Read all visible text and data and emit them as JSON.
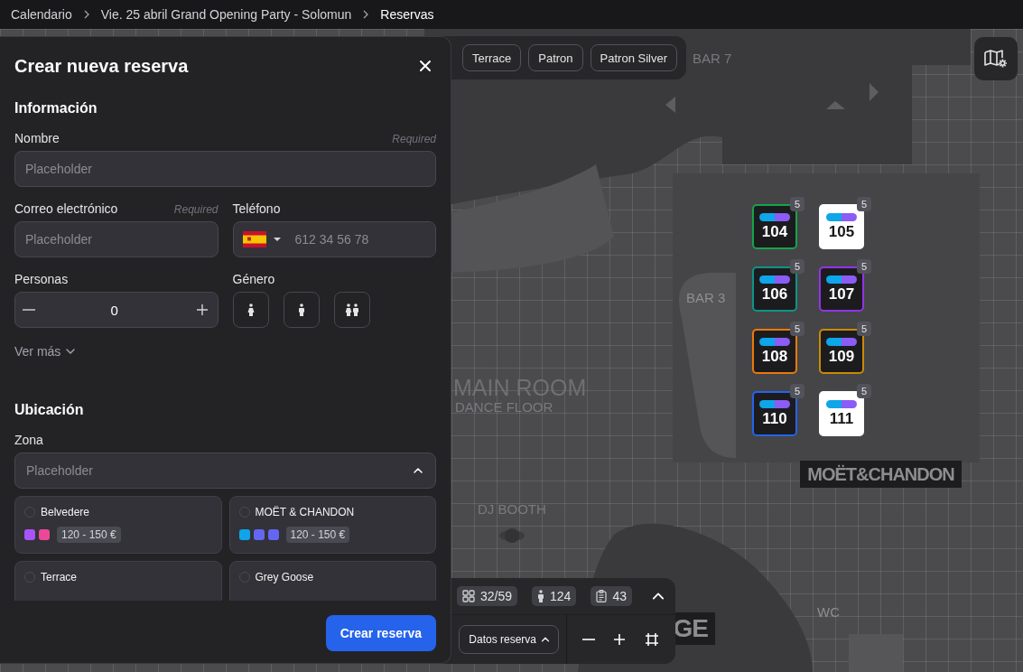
{
  "breadcrumbs": [
    {
      "label": "Calendario",
      "current": false
    },
    {
      "label": "Vie. 25 abril Grand Opening Party - Solomun",
      "current": false
    },
    {
      "label": "Reservas",
      "current": true
    }
  ],
  "zone_filters": [
    "Terrace",
    "Patron",
    "Patron Silver"
  ],
  "map": {
    "labels": [
      {
        "text": "BAR 7",
        "kind": "area"
      },
      {
        "text": "BAR 3",
        "kind": "area"
      },
      {
        "text": "MAIN ROOM",
        "kind": "room"
      },
      {
        "text": "DANCE FLOOR",
        "kind": "area"
      },
      {
        "text": "DJ BOOTH",
        "kind": "area"
      },
      {
        "text": "WC",
        "kind": "area"
      },
      {
        "text": "MOËT&CHANDON",
        "kind": "sign"
      },
      {
        "text": "GE",
        "kind": "sign"
      }
    ],
    "tables": [
      {
        "number": "104",
        "seats": "5",
        "color": "#16a34a",
        "selected": false
      },
      {
        "number": "105",
        "seats": "5",
        "selected": true
      },
      {
        "number": "106",
        "seats": "5",
        "color": "#0d9488",
        "selected": false
      },
      {
        "number": "107",
        "seats": "5",
        "color": "#9333ea",
        "selected": false
      },
      {
        "number": "108",
        "seats": "5",
        "color": "#ea7a0c",
        "selected": false
      },
      {
        "number": "109",
        "seats": "5",
        "color": "#ca8a04",
        "selected": false
      },
      {
        "number": "110",
        "seats": "5",
        "color": "#2563eb",
        "selected": false
      },
      {
        "number": "111",
        "seats": "5",
        "selected": true
      }
    ]
  },
  "form": {
    "title": "Crear nueva reserva",
    "info_heading": "Información",
    "name": {
      "label": "Nombre",
      "note": "Required",
      "placeholder": "Placeholder"
    },
    "email": {
      "label": "Correo electrónico",
      "note": "Required",
      "placeholder": "Placeholder"
    },
    "phone": {
      "label": "Teléfono",
      "placeholder": "612 34 56 78"
    },
    "people": {
      "label": "Personas",
      "value": "0"
    },
    "gender": {
      "label": "Género",
      "options": [
        {
          "kind": "female",
          "selected": false
        },
        {
          "kind": "male",
          "selected": false
        },
        {
          "kind": "couple",
          "selected": false
        }
      ]
    },
    "more": "Ver más",
    "location_heading": "Ubicación",
    "zone": {
      "label": "Zona",
      "placeholder": "Placeholder",
      "expanded": true
    },
    "zones": [
      {
        "name": "Belvedere",
        "selected": false,
        "swatches": [
          {
            "color": "#a855f7"
          },
          {
            "color": "#ec4899"
          }
        ],
        "price": "120 - 150 €"
      },
      {
        "name": "MOËT & CHANDON",
        "selected": false,
        "swatches": [
          {
            "color": "#0ea5e9"
          },
          {
            "color": "#6366f1"
          },
          {
            "color": "#6366f1"
          }
        ],
        "price": "120 - 150 €"
      },
      {
        "name": "Terrace",
        "selected": false
      },
      {
        "name": "Grey Goose",
        "selected": false
      }
    ],
    "submit": "Crear reserva"
  },
  "stats": [
    {
      "kind": "tables",
      "value": "32/59"
    },
    {
      "kind": "guests",
      "value": "124"
    },
    {
      "kind": "reservations",
      "value": "43"
    }
  ],
  "details_button": "Datos reserva"
}
